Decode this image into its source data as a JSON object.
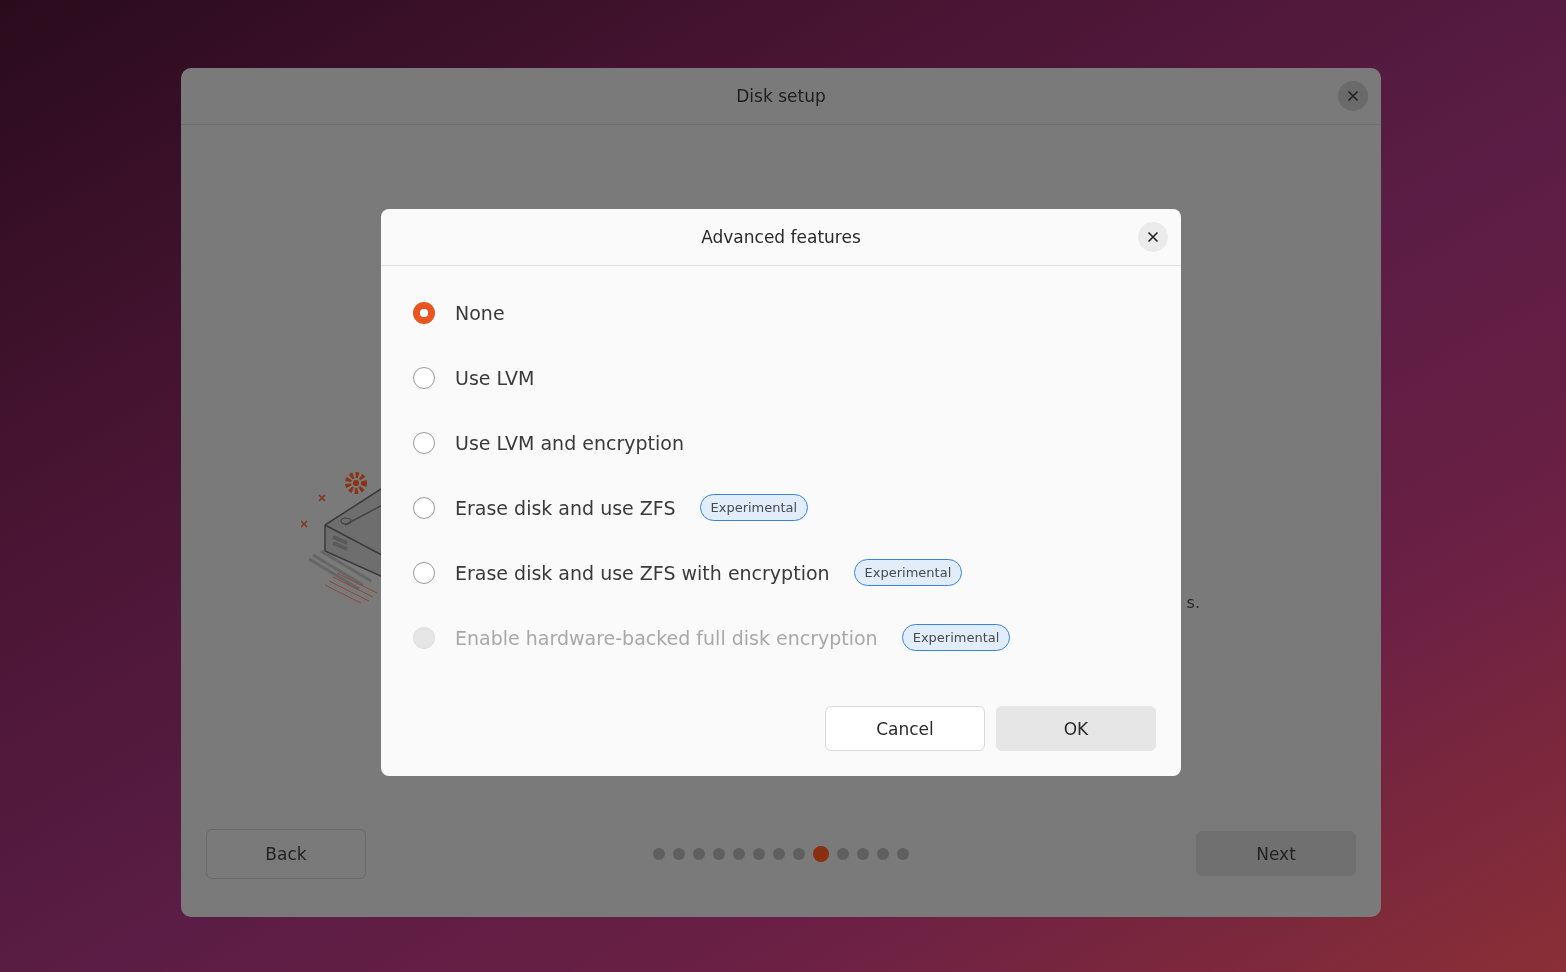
{
  "window": {
    "title": "Disk setup",
    "body_text": "s.",
    "back_button": "Back",
    "next_button": "Next",
    "pages": [
      {
        "selected": false
      },
      {
        "selected": false
      },
      {
        "selected": false
      },
      {
        "selected": false
      },
      {
        "selected": false
      },
      {
        "selected": false
      },
      {
        "selected": false
      },
      {
        "selected": false
      },
      {
        "selected": true
      },
      {
        "selected": false
      },
      {
        "selected": false
      },
      {
        "selected": false
      },
      {
        "selected": false
      }
    ]
  },
  "dialog": {
    "title": "Advanced features",
    "options": [
      {
        "label": "None",
        "selected": true,
        "disabled": false
      },
      {
        "label": "Use LVM",
        "selected": false,
        "disabled": false
      },
      {
        "label": "Use LVM and encryption",
        "selected": false,
        "disabled": false
      },
      {
        "label": "Erase disk and use ZFS",
        "selected": false,
        "disabled": false,
        "badge": "Experimental"
      },
      {
        "label": "Erase disk and use ZFS with encryption",
        "selected": false,
        "disabled": false,
        "badge": "Experimental"
      },
      {
        "label": "Enable hardware-backed full disk encryption",
        "selected": false,
        "disabled": true,
        "badge": "Experimental"
      }
    ],
    "buttons": [
      {
        "label": "Cancel",
        "kind": "secondary"
      },
      {
        "label": "OK",
        "kind": "primary"
      }
    ]
  }
}
